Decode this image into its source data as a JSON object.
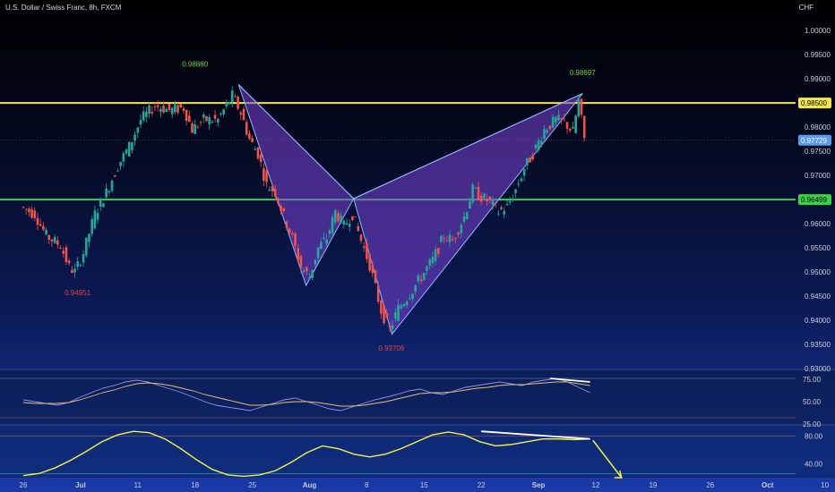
{
  "header": {
    "title": "U.S. Dollar / Swiss Franc, 8h, FXCM",
    "currency": "CHF"
  },
  "chart_data": {
    "type": "candlestick",
    "symbol": "U.S. Dollar / Swiss Franc",
    "interval": "8h",
    "broker": "FXCM",
    "currency": "CHF",
    "ylim": [
      0.93,
      1.003
    ],
    "ytick_labels": [
      "1.00000",
      "0.99500",
      "0.99000",
      "0.98000",
      "0.97500",
      "0.97000",
      "0.96000",
      "0.95500",
      "0.95000",
      "0.94500",
      "0.94000",
      "0.93500",
      "0.93000"
    ],
    "xtick_labels": [
      "26",
      "Jul",
      "11",
      "18",
      "25",
      "Aug",
      "8",
      "15",
      "22",
      "Sep",
      "12",
      "19",
      "26",
      "Oct",
      "10"
    ],
    "xtick_index": [
      0,
      1,
      2,
      3,
      4,
      5,
      6,
      7,
      8,
      9,
      10,
      11,
      12,
      13,
      14
    ],
    "horizontal_lines": [
      {
        "value": 0.985,
        "label": "0.98500",
        "color": "#f5e642"
      },
      {
        "value": 0.96499,
        "label": "0.96499",
        "color": "#35d447"
      }
    ],
    "last_price": {
      "value": 0.97729,
      "label": "0.97729",
      "color": "#5b9bf0"
    },
    "pattern": {
      "points": [
        {
          "t": 3.76,
          "v": 0.9888
        },
        {
          "t": 4.94,
          "v": 0.9472
        },
        {
          "t": 5.77,
          "v": 0.9652
        },
        {
          "t": 6.44,
          "v": 0.9371
        },
        {
          "t": 9.77,
          "v": 0.98697
        }
      ],
      "labels": [
        {
          "text": "0.98880",
          "t": 3.0,
          "v": 0.9925,
          "color": "#6fcf4d"
        },
        {
          "text": "0.94951",
          "t": 0.95,
          "v": 0.9452,
          "color": "#e0433b"
        },
        {
          "text": "0.93706",
          "t": 6.43,
          "v": 0.9337,
          "color": "#e0433b"
        },
        {
          "text": "0.98697",
          "t": 9.77,
          "v": 0.9908,
          "color": "#6fcf4d"
        }
      ],
      "fill": "#7a44d6",
      "stroke": "#8fb6ff"
    },
    "price_path": [
      [
        0.0,
        0.9635
      ],
      [
        0.25,
        0.962
      ],
      [
        0.45,
        0.9575
      ],
      [
        0.7,
        0.9555
      ],
      [
        0.85,
        0.951
      ],
      [
        0.95,
        0.95
      ],
      [
        1.1,
        0.954
      ],
      [
        1.3,
        0.962
      ],
      [
        1.5,
        0.9665
      ],
      [
        1.7,
        0.972
      ],
      [
        1.9,
        0.976
      ],
      [
        2.1,
        0.9815
      ],
      [
        2.35,
        0.9845
      ],
      [
        2.6,
        0.9835
      ],
      [
        2.85,
        0.984
      ],
      [
        3.0,
        0.9795
      ],
      [
        3.2,
        0.9815
      ],
      [
        3.45,
        0.9815
      ],
      [
        3.7,
        0.9865
      ],
      [
        3.85,
        0.983
      ],
      [
        4.0,
        0.9775
      ],
      [
        4.15,
        0.9745
      ],
      [
        4.3,
        0.968
      ],
      [
        4.45,
        0.9665
      ],
      [
        4.6,
        0.9615
      ],
      [
        4.75,
        0.957
      ],
      [
        4.9,
        0.951
      ],
      [
        5.05,
        0.949
      ],
      [
        5.2,
        0.955
      ],
      [
        5.35,
        0.957
      ],
      [
        5.5,
        0.9625
      ],
      [
        5.65,
        0.9595
      ],
      [
        5.8,
        0.962
      ],
      [
        5.95,
        0.9565
      ],
      [
        6.1,
        0.9515
      ],
      [
        6.3,
        0.942
      ],
      [
        6.45,
        0.938
      ],
      [
        6.6,
        0.9425
      ],
      [
        6.8,
        0.9455
      ],
      [
        7.0,
        0.949
      ],
      [
        7.2,
        0.9525
      ],
      [
        7.4,
        0.9575
      ],
      [
        7.55,
        0.9565
      ],
      [
        7.75,
        0.9615
      ],
      [
        7.9,
        0.967
      ],
      [
        8.05,
        0.9655
      ],
      [
        8.2,
        0.9645
      ],
      [
        8.35,
        0.9625
      ],
      [
        8.5,
        0.9635
      ],
      [
        8.65,
        0.967
      ],
      [
        8.8,
        0.9715
      ],
      [
        8.95,
        0.9745
      ],
      [
        9.15,
        0.9795
      ],
      [
        9.35,
        0.9815
      ],
      [
        9.5,
        0.981
      ],
      [
        9.65,
        0.979
      ],
      [
        9.75,
        0.9855
      ],
      [
        9.85,
        0.9775
      ]
    ],
    "rsi": {
      "ylim": [
        25,
        85
      ],
      "tick_labels": [
        "75.00",
        "50.00",
        "25.00"
      ],
      "band_lines": [
        76,
        32
      ],
      "rsi": [
        52,
        50,
        48,
        46,
        49,
        55,
        60,
        65,
        68,
        72,
        74,
        72,
        68,
        64,
        60,
        55,
        50,
        46,
        44,
        42,
        40,
        44,
        48,
        52,
        54,
        50,
        46,
        42,
        40,
        44,
        48,
        52,
        55,
        58,
        62,
        64,
        60,
        58,
        62,
        66,
        68,
        70,
        72,
        70,
        68,
        72,
        74,
        76,
        72,
        66,
        60
      ],
      "ma": [
        49,
        48,
        48,
        48,
        49,
        52,
        56,
        60,
        63,
        67,
        70,
        71,
        70,
        68,
        65,
        62,
        58,
        55,
        52,
        49,
        46,
        46,
        47,
        49,
        50,
        50,
        49,
        47,
        45,
        45,
        46,
        48,
        50,
        53,
        56,
        59,
        60,
        60,
        61,
        63,
        65,
        66,
        68,
        69,
        69,
        70,
        71,
        72,
        72,
        70,
        68
      ],
      "divergence_line": [
        [
          9.2,
          76
        ],
        [
          9.9,
          72
        ]
      ]
    },
    "osc": {
      "ylim": [
        20,
        95
      ],
      "tick_labels": [
        "80.00",
        "40.00"
      ],
      "band_lines": [
        80,
        26
      ],
      "line": [
        23,
        26,
        34,
        45,
        58,
        72,
        82,
        87,
        85,
        76,
        62,
        46,
        32,
        24,
        22,
        24,
        30,
        42,
        56,
        66,
        62,
        54,
        50,
        54,
        62,
        72,
        82,
        86,
        82,
        72,
        66,
        68,
        72,
        76,
        76,
        75,
        76
      ],
      "divergence_line": [
        [
          8.0,
          87
        ],
        [
          9.9,
          76
        ]
      ],
      "arrow": [
        [
          9.95,
          74
        ],
        [
          10.45,
          20
        ]
      ]
    }
  }
}
